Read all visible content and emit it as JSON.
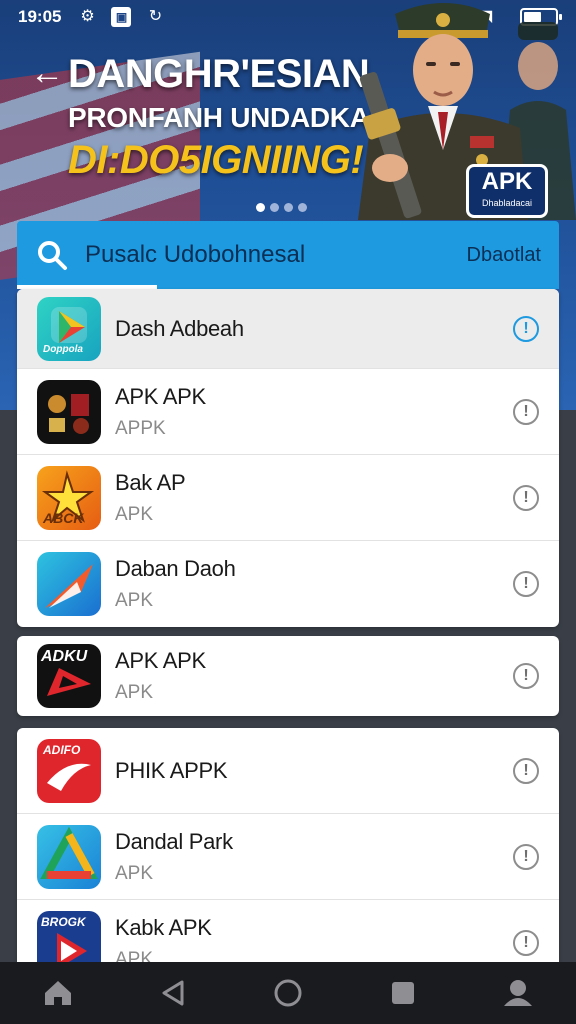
{
  "status": {
    "time": "19:05",
    "icons": [
      "gear-icon",
      "image-icon",
      "sync-icon",
      "bluetooth-icon",
      "wifi-icon",
      "battery-icon"
    ]
  },
  "banner": {
    "line1": "DANGHR'ESIAN",
    "line2": "PRONFANH UNDADKAN",
    "line3": "DI:DO5IGNIING!",
    "badge_title": "APK",
    "badge_sub": "Dhabladacai",
    "carousel_count": 4,
    "carousel_active": 0
  },
  "search": {
    "text": "Pusalc Udobohnesal",
    "button": "Dbaotlat"
  },
  "apps": [
    {
      "name": "Dash Adbeah",
      "sub": "",
      "icon_label": "Doppola",
      "icon": "play-icon",
      "highlight": true
    },
    {
      "name": "APK APK",
      "sub": "APPK",
      "icon_label": "",
      "icon": "apk-mosaic-icon"
    },
    {
      "name": "Bak AP",
      "sub": "APK",
      "icon_label": "ABCK",
      "icon": "star-icon"
    },
    {
      "name": "Daban Daoh",
      "sub": "APK",
      "icon_label": "",
      "icon": "swoosh-icon"
    },
    {
      "name": "APK APK",
      "sub": "APK",
      "icon_label": "ADKU",
      "icon": "triangle-icon"
    },
    {
      "name": "PHIK APPK",
      "sub": "",
      "icon_label": "ADIFO",
      "icon": "wave-icon"
    },
    {
      "name": "Dandal Park",
      "sub": "APK",
      "icon_label": "",
      "icon": "drive-icon"
    },
    {
      "name": "Kabk APK",
      "sub": "APK",
      "icon_label": "BROGK",
      "icon": "play-icon"
    }
  ],
  "nav": [
    "home-icon",
    "back-icon",
    "circle-home-icon",
    "recents-icon",
    "profile-icon"
  ],
  "colors": {
    "accent": "#1e9ae0",
    "banner": "#1f4f96",
    "gold": "#f4c21b"
  }
}
